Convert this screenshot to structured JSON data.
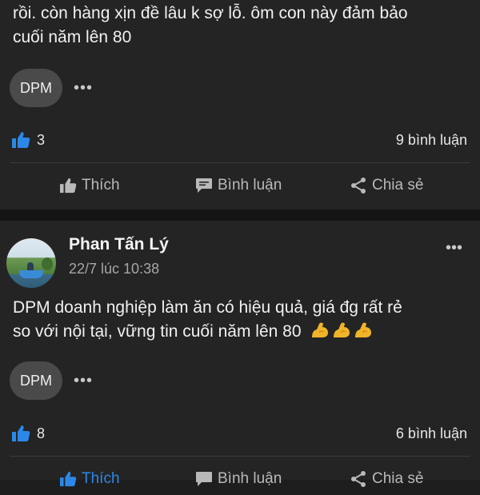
{
  "posts": [
    {
      "text_line1": "rồi. còn hàng xịn đề lâu k sợ lỗ. ôm con này đảm bảo",
      "text_line2": "cuối năm lên 80",
      "tag": "DPM",
      "menu_dots": "•••",
      "like_count": "3",
      "comment_count_label": "9 bình luận",
      "actions": {
        "like": "Thích",
        "comment": "Bình luận",
        "share": "Chia sẻ"
      },
      "liked": false
    },
    {
      "author": "Phan Tấn Lý",
      "time": "22/7 lúc 10:38",
      "header_menu": "•••",
      "text_line1": "DPM doanh nghiệp làm ăn có hiệu quả, giá đg rất rẻ",
      "text_line2": "so với nội tại, vững tin cuối năm lên 80",
      "emoji": [
        "flexed-biceps",
        "flexed-biceps",
        "flexed-biceps"
      ],
      "tag": "DPM",
      "menu_dots": "•••",
      "like_count": "8",
      "comment_count_label": "6 bình luận",
      "actions": {
        "like": "Thích",
        "comment": "Bình luận",
        "share": "Chia sẻ"
      },
      "liked": true
    }
  ],
  "colors": {
    "accent": "#2b88e8",
    "background": "#242424",
    "separator": "#141414"
  }
}
